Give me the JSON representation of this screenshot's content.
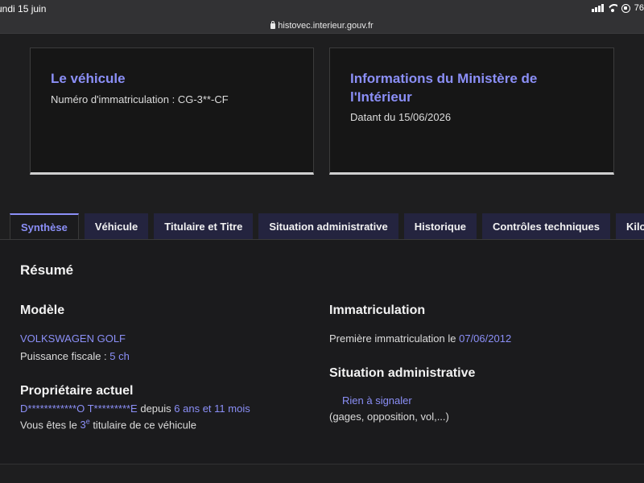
{
  "status": {
    "time": "undi 15 juin",
    "battery": "76"
  },
  "browser": {
    "url": "histovec.interieur.gouv.fr"
  },
  "card_vehicle": {
    "title": "Le véhicule",
    "label": "Numéro d'immatriculation : ",
    "plate": "CG-3**-CF"
  },
  "card_ministry": {
    "title": "Informations du Ministère de l'Intérieur",
    "date_text": "Datant du 15/06/2026"
  },
  "tabs": [
    "Synthèse",
    "Véhicule",
    "Titulaire et Titre",
    "Situation administrative",
    "Historique",
    "Contrôles techniques",
    "Kilo"
  ],
  "summary": {
    "title": "Résumé",
    "model": {
      "heading": "Modèle",
      "name": "VOLKSWAGEN GOLF",
      "power_label": "Puissance fiscale : ",
      "power_value": "5 ch"
    },
    "owner": {
      "heading": "Propriétaire actuel",
      "name": "D************O T*********E",
      "since_label": " depuis ",
      "duration": "6 ans et 11 mois",
      "rank_prefix": "Vous êtes le ",
      "rank_number": "3",
      "rank_sup": "e",
      "rank_suffix": " titulaire de ce véhicule"
    },
    "registration": {
      "heading": "Immatriculation",
      "label": "Première immatriculation le ",
      "date": "07/06/2012"
    },
    "admin": {
      "heading": "Situation administrative",
      "status": "Rien à signaler",
      "detail": "(gages, opposition, vol,...)"
    }
  },
  "colors": {
    "accent": "#8b8ff7",
    "tab_bg": "#24243f",
    "page_bg": "#1e1e1f"
  }
}
